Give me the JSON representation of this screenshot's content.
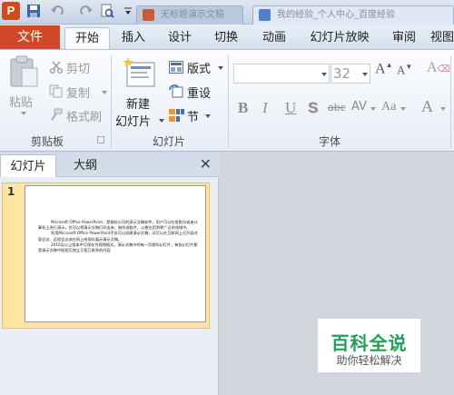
{
  "titlebar": {
    "app_icon": "P",
    "tabs": [
      {
        "label": "无标题演示文稿"
      },
      {
        "label": "我的经验_个人中心_百度经验"
      }
    ]
  },
  "ribbon_tabs": [
    "文件",
    "开始",
    "插入",
    "设计",
    "切换",
    "动画",
    "幻灯片放映",
    "审阅",
    "视图"
  ],
  "active_tab": "开始",
  "ribbon": {
    "clipboard": {
      "paste": "粘贴",
      "cut": "剪切",
      "copy": "复制",
      "format_painter": "格式刷",
      "group_label": "剪贴板"
    },
    "slides": {
      "new_slide_line1": "新建",
      "new_slide_line2": "幻灯片",
      "layout": "版式",
      "reset": "重设",
      "section": "节",
      "group_label": "幻灯片"
    },
    "font": {
      "font_name": "",
      "font_size": "32",
      "grow": "A",
      "shrink": "A",
      "clear": "A",
      "bold": "B",
      "italic": "I",
      "underline": "U",
      "shadow": "S",
      "strikethrough": "abc",
      "spacing": "AV",
      "case": "Aa",
      "color": "A",
      "group_label": "字体"
    }
  },
  "panel": {
    "tabs": [
      "幻灯片",
      "大纲"
    ],
    "close": "✕"
  },
  "slides": [
    {
      "number": "1",
      "paragraphs": [
        "Microsoft Office PowerPoint，是微软公司的演示文稿软件。用户可以在投影仪或者计算机上进行演示，也可以将演示文稿打印出来，制作成胶片，以便应用到更广泛的领域中。",
        "利用Microsoft Office PowerPoint不仅可以创建演示文稿，还可以在互联网上召开面对面会议、远程会议或在网上给观众展示演示文稿。",
        "2010及以上版本中可保存为视频格式。演示文稿中的每一页就叫幻灯片，每张幻灯片都是演示文稿中既相互独立又相互联系的内容"
      ]
    }
  ],
  "watermark": {
    "title": "百科全说",
    "subtitle": "助你轻松解决"
  },
  "colors": {
    "file_tab": "#d24726",
    "selected_slide": "#fde6a2",
    "watermark_green": "#22a05a"
  }
}
